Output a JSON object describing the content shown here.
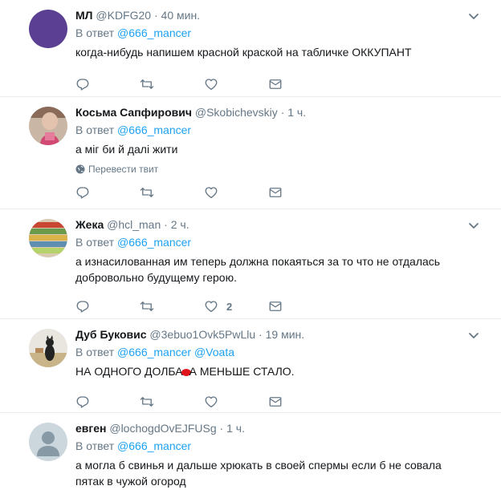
{
  "tweets": [
    {
      "name": "МЛ",
      "handle": "@KDFG20",
      "time": "40 мин.",
      "reply_prefix": "В ответ",
      "reply_mentions": [
        "@666_mancer"
      ],
      "text": "когда-нибудь напишем красной краской на табличке ОККУПАНТ",
      "avatar_color": "#5b3f93",
      "like_count": ""
    },
    {
      "name": "Косьма Сапфирович",
      "handle": "@Skobichevskiy",
      "time": "1 ч.",
      "reply_prefix": "В ответ",
      "reply_mentions": [
        "@666_mancer"
      ],
      "text": "а міг би й далі жити",
      "translate_label": "Перевести твит",
      "like_count": ""
    },
    {
      "name": "Жека",
      "handle": "@hcl_man",
      "time": "2 ч.",
      "reply_prefix": "В ответ",
      "reply_mentions": [
        "@666_mancer"
      ],
      "text": "а изнасилованная им теперь должна покаяться за то что не отдалась добровольно будущему герою.",
      "like_count": "2"
    },
    {
      "name": "Дуб Буковиc",
      "handle": "@3ebuo1Ovk5PwLlu",
      "time": "19 мин.",
      "reply_prefix": "В ответ",
      "reply_mentions": [
        "@666_mancer",
        "@Voata"
      ],
      "text_before": "НА ОДНОГО ДОЛБА",
      "text_after": "А МЕНЬШЕ СТАЛО.",
      "like_count": ""
    },
    {
      "name": "евген",
      "handle": "@lochogdOvEJFUSg",
      "time": "1 ч.",
      "reply_prefix": "В ответ",
      "reply_mentions": [
        "@666_mancer"
      ],
      "text": "а могла б свинья и дальше хрюкать в своей спермы если б не совала пятак в чужой огород",
      "like_count": ""
    }
  ],
  "dot": "·",
  "icons": [
    "reply-icon",
    "retweet-icon",
    "heart-icon",
    "dm-icon",
    "chevron-down-icon",
    "globe-icon"
  ]
}
